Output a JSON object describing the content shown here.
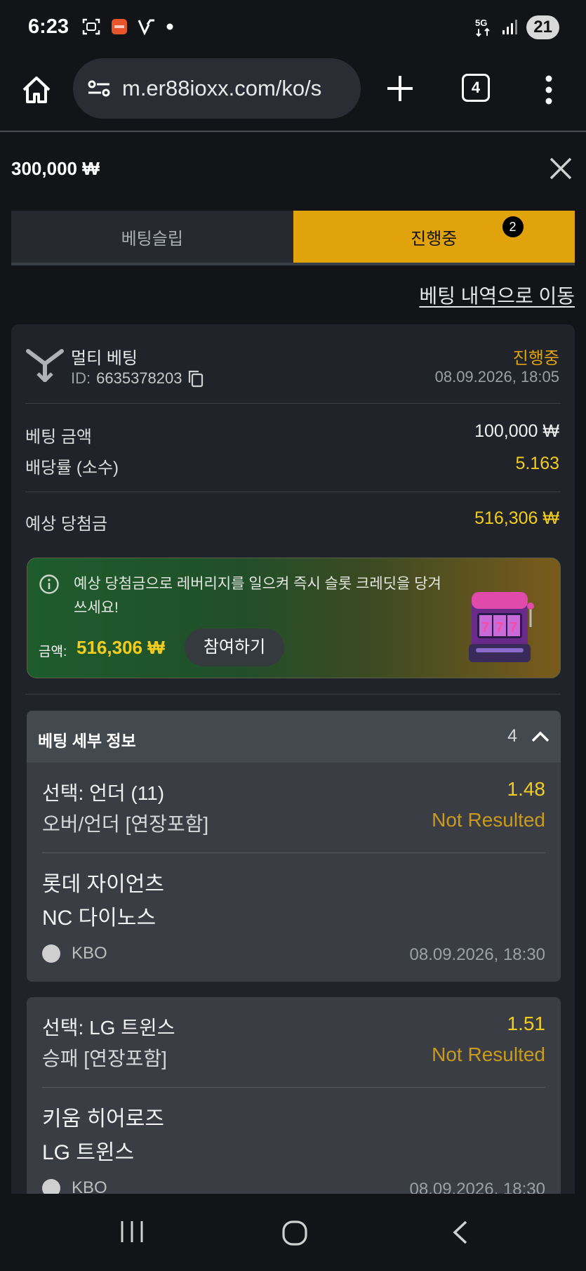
{
  "status_bar": {
    "time": "6:23",
    "network": "5G",
    "battery": "21"
  },
  "browser": {
    "url": "m.er88ioxx.com/ko/s",
    "tab_count": "4"
  },
  "header": {
    "balance": "300,000 ₩"
  },
  "tabs": [
    {
      "label": "베팅슬립",
      "active": false
    },
    {
      "label": "진행중",
      "active": true,
      "badge": "2"
    }
  ],
  "history_link": "베팅 내역으로 이동",
  "bet": {
    "type": "멀티 베팅",
    "id_label": "ID:",
    "id": "6635378203",
    "status": "진행중",
    "datetime": "08.09.2026, 18:05",
    "stake_label": "베팅 금액",
    "stake": "100,000 ₩",
    "odds_label": "배당률 (소수)",
    "odds": "5.163",
    "payout_label": "예상 당첨금",
    "payout": "516,306 ₩"
  },
  "promo": {
    "text": "예상 당첨금으로 레버리지를 일으켜 즉시 슬롯 크레딧을 당겨 쓰세요!",
    "amount_label": "금액:",
    "amount": "516,306 ₩",
    "button": "참여하기"
  },
  "details": {
    "title": "베팅 세부 정보",
    "count": "4"
  },
  "selections": [
    {
      "pick": "선택: 언더 (11)",
      "market": "오버/언더 [연장포함]",
      "odds": "1.48",
      "result": "Not Resulted",
      "home": "롯데 자이언츠",
      "away": "NC 다이노스",
      "league": "KBO",
      "time": "08.09.2026, 18:30"
    },
    {
      "pick": "선택: LG 트윈스",
      "market": "승패 [연장포함]",
      "odds": "1.51",
      "result": "Not Resulted",
      "home": "키움 히어로즈",
      "away": "LG 트윈스",
      "league": "KBO",
      "time": "08.09.2026, 18:30"
    }
  ],
  "colors": {
    "accent": "#e0a30b",
    "odds_yellow": "#f2cd1e",
    "background": "#121418",
    "card": "#202329"
  }
}
